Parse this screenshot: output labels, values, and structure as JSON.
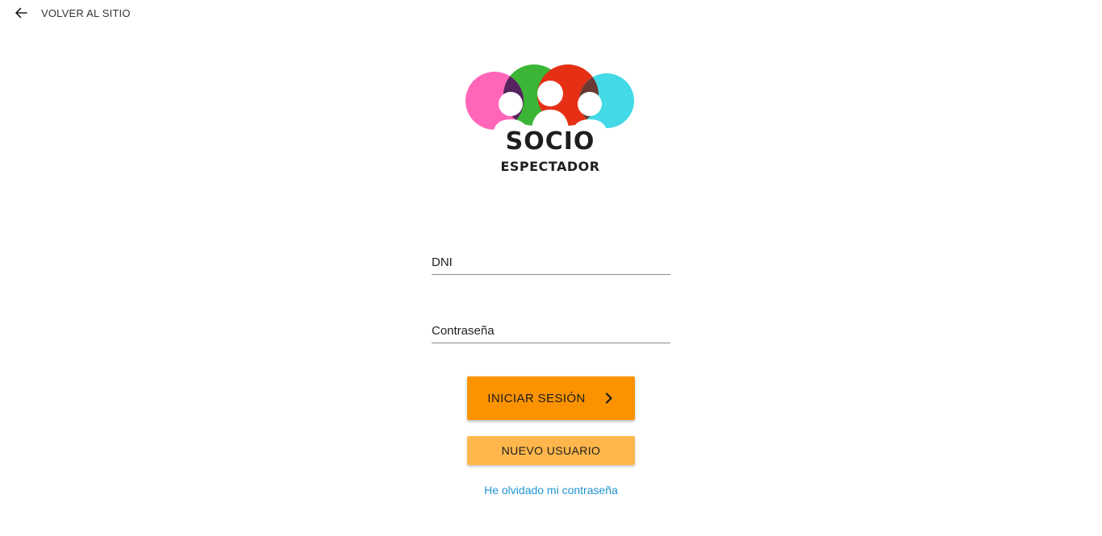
{
  "header": {
    "back_label": "VOLVER AL SITIO",
    "back_icon": "arrow-left-icon"
  },
  "logo": {
    "line1": "SOCIO",
    "line2": "ESPECTADOR",
    "colors": {
      "pink": "#ff66b8",
      "green": "#3ab535",
      "red": "#e63016",
      "cyan": "#43d9e6",
      "purple": "#55245e",
      "brown": "#6b3a33"
    }
  },
  "form": {
    "dni_placeholder": "DNI",
    "password_placeholder": "Contraseña"
  },
  "actions": {
    "login_label": "INICIAR SESIÓN",
    "login_icon": "chevron-right-icon",
    "register_label": "NUEVO USUARIO",
    "forgot_label": "He olvidado mi contraseña"
  },
  "theme": {
    "primary": "#fb9300",
    "secondary": "#ffb74d",
    "link": "#2196d3"
  }
}
